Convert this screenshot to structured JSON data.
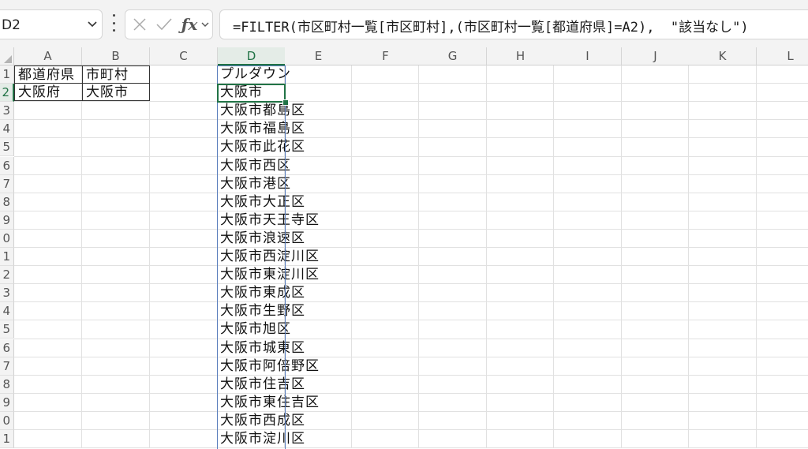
{
  "formula_bar": {
    "name_box": "D2",
    "formula": "=FILTER(市区町村一覧[市区町村],(市区町村一覧[都道府県]=A2),  \"該当なし\")"
  },
  "icons": {
    "name_box_dropdown": "chevron-down-icon",
    "more": "vertical-ellipsis-icon",
    "cancel": "close-icon",
    "enter": "checkmark-icon",
    "insert_function": "fx-icon",
    "function_dropdown": "chevron-down-icon"
  },
  "grid": {
    "columns": [
      "A",
      "B",
      "C",
      "D",
      "E",
      "F",
      "G",
      "H",
      "I",
      "J",
      "K",
      "L"
    ],
    "active_column": "D",
    "rows": [
      "1",
      "2",
      "3",
      "4",
      "5",
      "6",
      "7",
      "8",
      "9",
      "0",
      "1",
      "2",
      "3",
      "4",
      "5",
      "6",
      "7",
      "8",
      "9",
      "0",
      "1"
    ],
    "active_row_index": 1
  },
  "cells": {
    "A1": "都道府県",
    "B1": "市町村",
    "A2": "大阪府",
    "B2": "大阪市",
    "D1": "プルダウン"
  },
  "spill_values": [
    "大阪市",
    "大阪市都島区",
    "大阪市福島区",
    "大阪市此花区",
    "大阪市西区",
    "大阪市港区",
    "大阪市大正区",
    "大阪市天王寺区",
    "大阪市浪速区",
    "大阪市西淀川区",
    "大阪市東淀川区",
    "大阪市東成区",
    "大阪市生野区",
    "大阪市旭区",
    "大阪市城東区",
    "大阪市阿倍野区",
    "大阪市住吉区",
    "大阪市東住吉区",
    "大阪市西成区",
    "大阪市淀川区"
  ],
  "colors": {
    "selection": "#217346",
    "spill_border": "#5b7fbd",
    "header_bg": "#f3f3f3"
  }
}
